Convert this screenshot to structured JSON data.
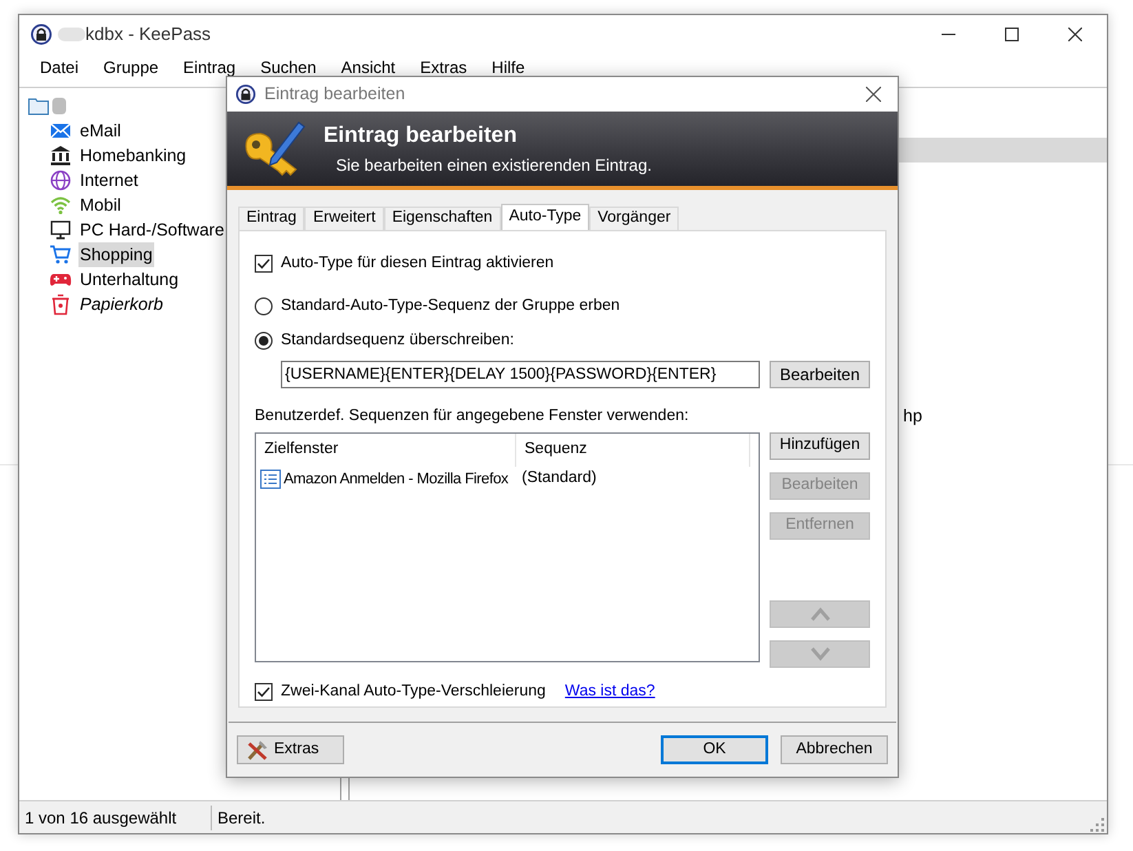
{
  "main_window": {
    "title": "kdbx - KeePass",
    "menu": [
      "Datei",
      "Gruppe",
      "Eintrag",
      "Suchen",
      "Ansicht",
      "Extras",
      "Hilfe"
    ],
    "groups": [
      {
        "label": "eMail",
        "selected": false,
        "italic": false
      },
      {
        "label": "Homebanking",
        "selected": false,
        "italic": false
      },
      {
        "label": "Internet",
        "selected": false,
        "italic": false
      },
      {
        "label": "Mobil",
        "selected": false,
        "italic": false
      },
      {
        "label": "PC Hard-/Software",
        "selected": false,
        "italic": false
      },
      {
        "label": "Shopping",
        "selected": true,
        "italic": false
      },
      {
        "label": "Unterhaltung",
        "selected": false,
        "italic": false
      },
      {
        "label": "Papierkorb",
        "selected": false,
        "italic": true
      }
    ],
    "entries": [
      {
        "selected": true
      },
      {
        "text": "hp",
        "selected": false
      }
    ],
    "status_bar": [
      "1 von 16 ausgewählt",
      "Bereit."
    ]
  },
  "dialog": {
    "title": "Eintrag bearbeiten",
    "banner_title": "Eintrag bearbeiten",
    "banner_subtitle": "Sie bearbeiten einen existierenden Eintrag.",
    "tabs": [
      {
        "label": "Eintrag",
        "selected": false
      },
      {
        "label": "Erweitert",
        "selected": false
      },
      {
        "label": "Eigenschaften",
        "selected": false
      },
      {
        "label": "Auto-Type",
        "selected": true
      },
      {
        "label": "Vorgänger",
        "selected": false
      }
    ],
    "enable": {
      "label": "Auto-Type für diesen Eintrag aktivieren",
      "checked": true
    },
    "radios": [
      {
        "label": "Standard-Auto-Type-Sequenz der Gruppe erben",
        "selected": false
      },
      {
        "label": "Standardsequenz überschreiben:",
        "selected": true
      }
    ],
    "sequence": {
      "value": "{USERNAME}{ENTER}{DELAY 1500}{PASSWORD}{ENTER}",
      "button": "Bearbeiten"
    },
    "custom_label": "Benutzerdef. Sequenzen für angegebene Fenster verwenden:",
    "table": {
      "columns": [
        "Zielfenster",
        "Sequenz"
      ],
      "rows": [
        {
          "cells": [
            "Amazon Anmelden - Mozilla Firefox",
            "(Standard)"
          ]
        }
      ]
    },
    "side_buttons": [
      {
        "kind": "text",
        "label": "Hinzufügen",
        "disabled": false
      },
      {
        "kind": "text",
        "label": "Bearbeiten",
        "disabled": true
      },
      {
        "kind": "text",
        "label": "Entfernen",
        "disabled": true
      },
      {
        "kind": "up",
        "disabled": true
      },
      {
        "kind": "down",
        "disabled": true
      }
    ],
    "obfuscation": {
      "label": "Zwei-Kanal Auto-Type-Verschleierung",
      "checked": true,
      "link": "Was ist das?"
    },
    "footer": {
      "extras": "Extras",
      "ok": "OK",
      "cancel": "Abbrechen"
    }
  }
}
